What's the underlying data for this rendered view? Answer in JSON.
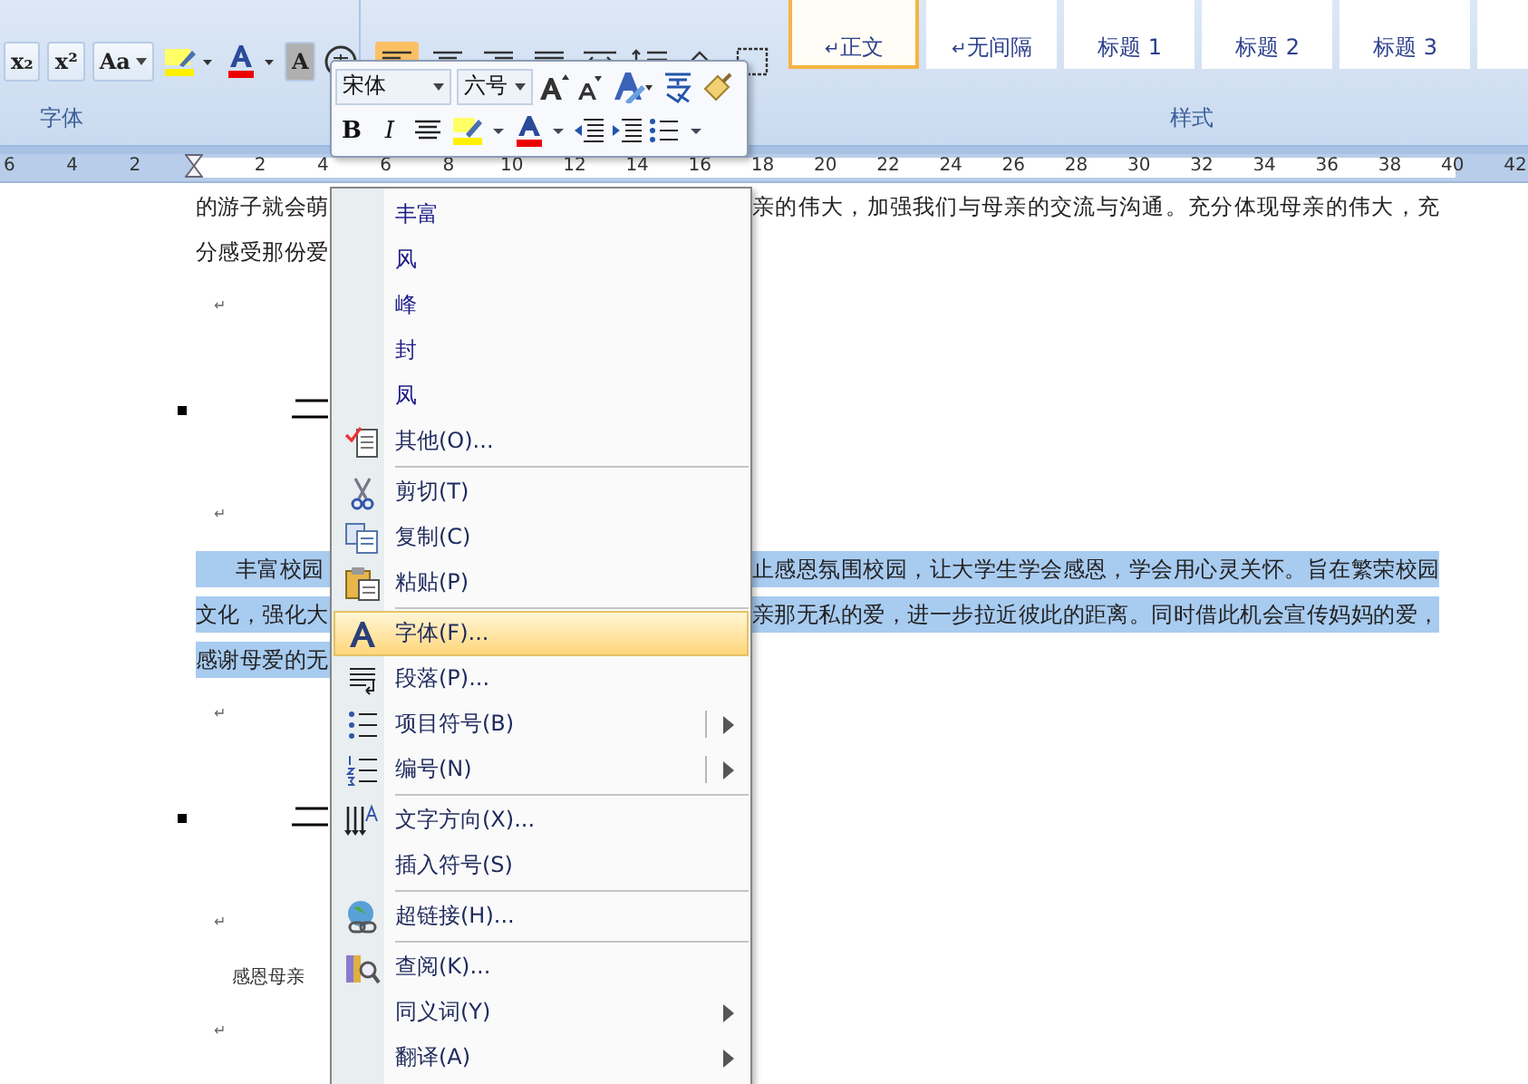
{
  "ribbon": {
    "font_group": {
      "label": "字体",
      "buttons": [
        {
          "label": "x₂",
          "kind": "text"
        },
        {
          "label": "x²",
          "kind": "text"
        },
        {
          "label": "Aa",
          "kind": "case"
        },
        {
          "kind": "highlight"
        },
        {
          "kind": "fontcolor"
        },
        {
          "label": "A",
          "kind": "shade"
        },
        {
          "kind": "enclose"
        }
      ]
    },
    "paragraph_group": {
      "buttons": [
        {
          "kind": "align-left",
          "selected": true
        },
        {
          "kind": "align-center",
          "selected": false
        },
        {
          "kind": "align-right",
          "selected": false
        },
        {
          "kind": "justify",
          "selected": false
        },
        {
          "kind": "distribute",
          "selected": false
        },
        {
          "kind": "line-spacing",
          "selected": false
        },
        {
          "kind": "shading",
          "selected": false
        },
        {
          "kind": "borders",
          "selected": false
        }
      ]
    },
    "styles_group": {
      "label": "样式",
      "styles": [
        {
          "name": "正文",
          "para_mark": "↵",
          "selected": true
        },
        {
          "name": "无间隔",
          "para_mark": "↵",
          "selected": false
        },
        {
          "name": "标题 1",
          "selected": false
        },
        {
          "name": "标题 2",
          "selected": false
        },
        {
          "name": "标题 3",
          "selected": false
        },
        {
          "selected": false
        }
      ]
    }
  },
  "ruler": {
    "left_labels": [
      "6",
      "4",
      "2"
    ],
    "right_labels": [
      "2",
      "4",
      "6",
      "8",
      "10",
      "12",
      "14",
      "16",
      "18",
      "20",
      "22",
      "24",
      "26",
      "28",
      "30",
      "32",
      "34",
      "36",
      "38",
      "40",
      "42"
    ]
  },
  "document": [
    {
      "kind": "text",
      "left": "的游子就会萌",
      "right": "亲的伟大，加强我们与母亲的交流与沟通。充分体现母亲的伟大，充",
      "selected": false,
      "indent": false
    },
    {
      "kind": "text",
      "left": "分感受那份爱",
      "selected": false,
      "indent": false
    },
    {
      "kind": "mark",
      "mark": "↵"
    },
    {
      "kind": "heading"
    },
    {
      "kind": "mark",
      "mark": "↵"
    },
    {
      "kind": "text",
      "left": "丰富校园",
      "right": "止感恩氛围校园，让大学生学会感恩，学会用心灵关怀。旨在繁荣校园",
      "selected": true,
      "indent": true
    },
    {
      "kind": "text",
      "left": "文化，强化大",
      "right": "亲那无私的爱，进一步拉近彼此的距离。同时借此机会宣传妈妈的爱，",
      "selected": true,
      "indent": false
    },
    {
      "kind": "text",
      "left": "感谢母爱的无",
      "selected": true,
      "indent": false
    },
    {
      "kind": "mark",
      "mark": "↵"
    },
    {
      "kind": "heading"
    },
    {
      "kind": "mark",
      "mark": "↵"
    },
    {
      "kind": "small",
      "text": "感恩母亲"
    },
    {
      "kind": "mark",
      "mark": "↵"
    }
  ],
  "mini_toolbar": {
    "font": "宋体",
    "size": "六号",
    "bold": "B",
    "italic": "I"
  },
  "context_menu": {
    "groups": [
      [
        {
          "label": "丰富",
          "kind": "suggestion",
          "selected": false,
          "submenu": false,
          "split": false
        },
        {
          "label": "风",
          "kind": "suggestion",
          "selected": false,
          "submenu": false,
          "split": false
        },
        {
          "label": "峰",
          "kind": "suggestion",
          "selected": false,
          "submenu": false,
          "split": false
        },
        {
          "label": "封",
          "kind": "suggestion",
          "selected": false,
          "submenu": false,
          "split": false
        },
        {
          "label": "凤",
          "kind": "suggestion",
          "selected": false,
          "submenu": false,
          "split": false
        },
        {
          "label": "其他(O)...",
          "kind": "more",
          "selected": false,
          "submenu": false,
          "split": false
        }
      ],
      [
        {
          "label": "剪切(T)",
          "kind": "cut",
          "selected": false,
          "submenu": false,
          "split": false
        },
        {
          "label": "复制(C)",
          "kind": "copy",
          "selected": false,
          "submenu": false,
          "split": false
        },
        {
          "label": "粘贴(P)",
          "kind": "paste",
          "selected": false,
          "submenu": false,
          "split": false
        }
      ],
      [
        {
          "label": "字体(F)...",
          "kind": "font",
          "selected": true,
          "submenu": false,
          "split": false
        },
        {
          "label": "段落(P)...",
          "kind": "paragraph",
          "selected": false,
          "submenu": false,
          "split": false
        },
        {
          "label": "项目符号(B)",
          "kind": "bullets",
          "selected": false,
          "submenu": true,
          "split": true
        },
        {
          "label": "编号(N)",
          "kind": "numbering",
          "selected": false,
          "submenu": true,
          "split": true
        }
      ],
      [
        {
          "label": "文字方向(X)...",
          "kind": "direction",
          "selected": false,
          "submenu": false,
          "split": false
        },
        {
          "label": "插入符号(S)",
          "kind": "plain",
          "selected": false,
          "submenu": false,
          "split": false
        }
      ],
      [
        {
          "label": "超链接(H)...",
          "kind": "link",
          "selected": false,
          "submenu": false,
          "split": false
        }
      ],
      [
        {
          "label": "查阅(K)...",
          "kind": "research",
          "selected": false,
          "submenu": false,
          "split": false
        },
        {
          "label": "同义词(Y)",
          "kind": "plain",
          "selected": false,
          "submenu": true,
          "split": false
        },
        {
          "label": "翻译(A)",
          "kind": "plain",
          "selected": false,
          "submenu": true,
          "split": false
        }
      ]
    ]
  }
}
